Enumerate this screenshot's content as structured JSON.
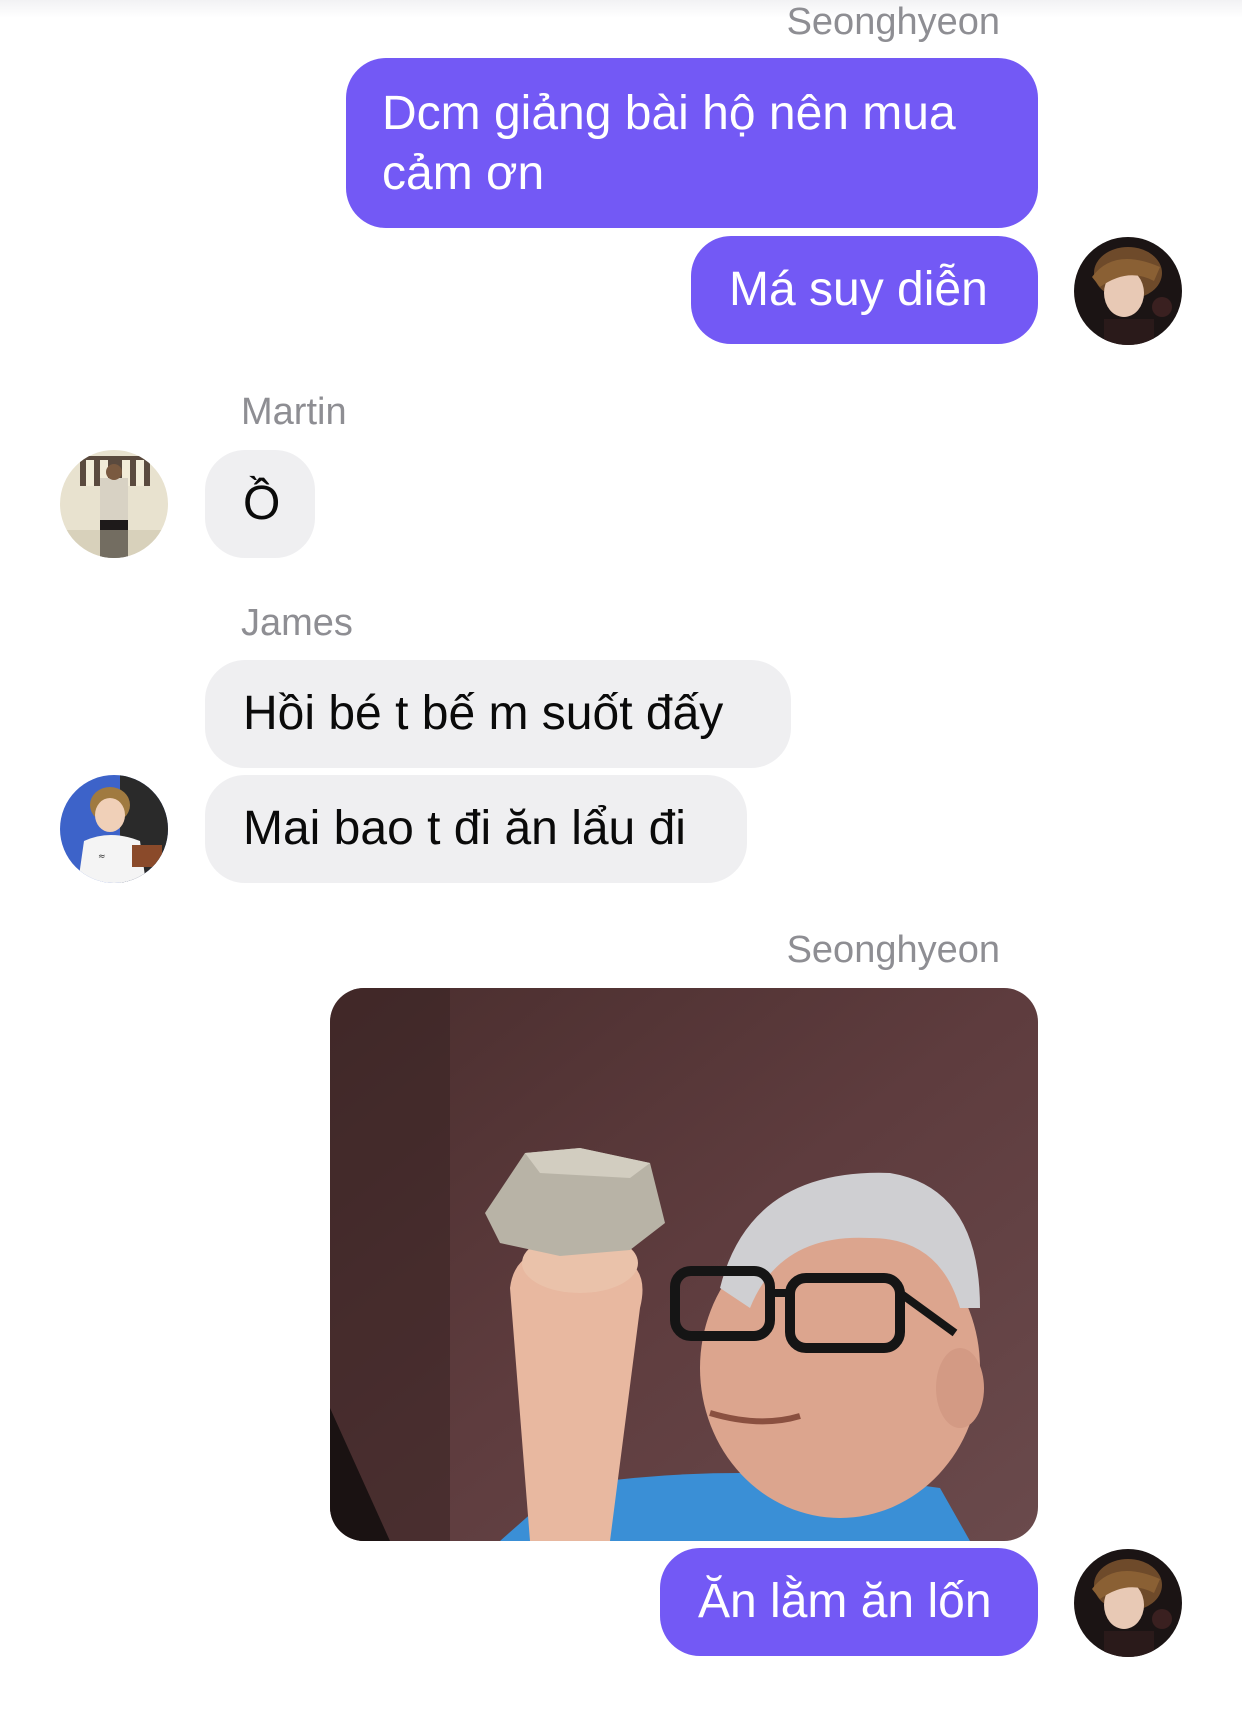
{
  "chat": {
    "sender_top": "Seonghyeon",
    "msg1": "Dcm giảng bài hộ nên mua cảm ơn",
    "msg2": "Má suy diễn",
    "sender_martin": "Martin",
    "msg3": "Ồ",
    "sender_james": "James",
    "msg4": "Hồi bé t bế m suốt đấy",
    "msg5": "Mai bao t đi ăn lẩu đi",
    "sender_bottom": "Seonghyeon",
    "msg6": "Ăn lằm ăn lốn"
  },
  "icons": {
    "avatar_seonghyeon": "avatar-seonghyeon",
    "avatar_martin": "avatar-martin",
    "avatar_james": "avatar-james",
    "meme_image": "meme-man-holding-rock"
  },
  "colors": {
    "outgoing_bubble": "#7359f5",
    "incoming_bubble": "#efeff1",
    "sender_name": "#8e8e93",
    "background": "#ffffff"
  }
}
